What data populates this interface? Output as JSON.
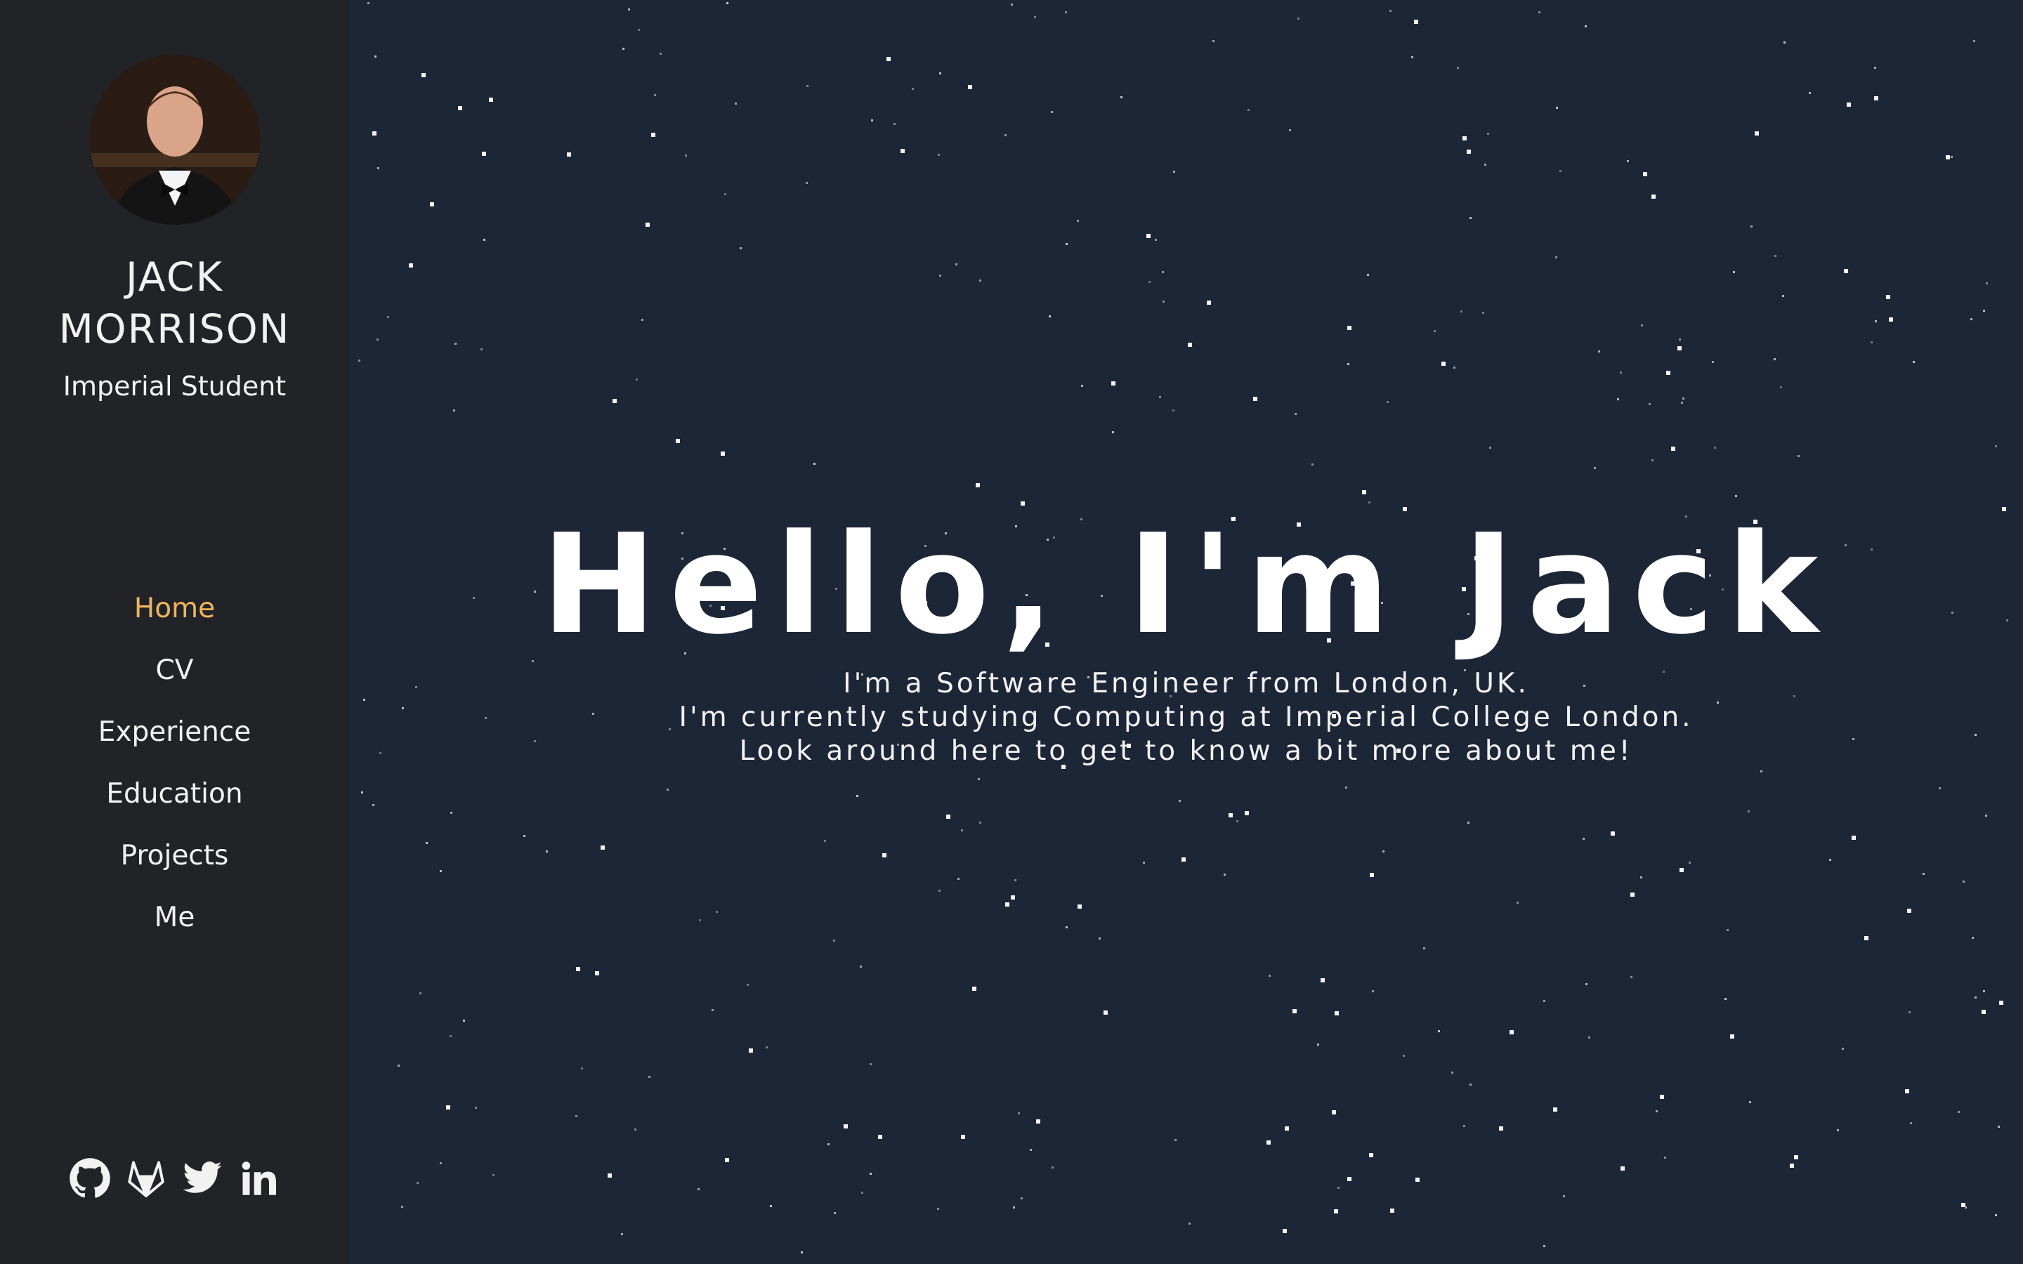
{
  "sidebar": {
    "name_line1": "JACK",
    "name_line2": "MORRISON",
    "tagline": "Imperial Student",
    "nav": [
      {
        "label": "Home",
        "active": true
      },
      {
        "label": "CV",
        "active": false
      },
      {
        "label": "Experience",
        "active": false
      },
      {
        "label": "Education",
        "active": false
      },
      {
        "label": "Projects",
        "active": false
      },
      {
        "label": "Me",
        "active": false
      }
    ],
    "socials": [
      "github-icon",
      "gitlab-icon",
      "twitter-icon",
      "linkedin-icon"
    ]
  },
  "hero": {
    "title": "Hello, I'm Jack",
    "lines": [
      "I'm a Software Engineer from London, UK.",
      "I'm currently studying Computing at Imperial College London.",
      "Look around here to get to know a bit more about me!"
    ]
  },
  "colors": {
    "sidebar_bg": "#222327",
    "main_bg": "#1d2636",
    "active_nav": "#f0b45c",
    "text": "#f2f2f2"
  }
}
